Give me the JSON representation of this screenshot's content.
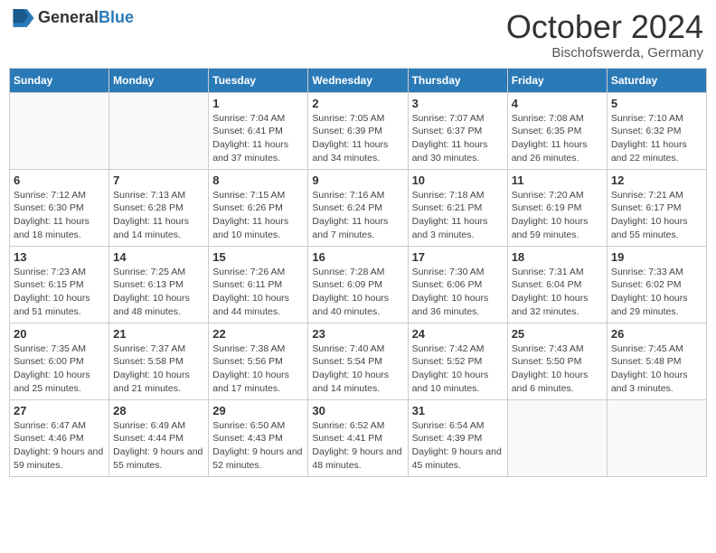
{
  "header": {
    "logo_general": "General",
    "logo_blue": "Blue",
    "month_title": "October 2024",
    "location": "Bischofswerda, Germany"
  },
  "days_of_week": [
    "Sunday",
    "Monday",
    "Tuesday",
    "Wednesday",
    "Thursday",
    "Friday",
    "Saturday"
  ],
  "weeks": [
    [
      {
        "day": "",
        "info": ""
      },
      {
        "day": "",
        "info": ""
      },
      {
        "day": "1",
        "info": "Sunrise: 7:04 AM\nSunset: 6:41 PM\nDaylight: 11 hours and 37 minutes."
      },
      {
        "day": "2",
        "info": "Sunrise: 7:05 AM\nSunset: 6:39 PM\nDaylight: 11 hours and 34 minutes."
      },
      {
        "day": "3",
        "info": "Sunrise: 7:07 AM\nSunset: 6:37 PM\nDaylight: 11 hours and 30 minutes."
      },
      {
        "day": "4",
        "info": "Sunrise: 7:08 AM\nSunset: 6:35 PM\nDaylight: 11 hours and 26 minutes."
      },
      {
        "day": "5",
        "info": "Sunrise: 7:10 AM\nSunset: 6:32 PM\nDaylight: 11 hours and 22 minutes."
      }
    ],
    [
      {
        "day": "6",
        "info": "Sunrise: 7:12 AM\nSunset: 6:30 PM\nDaylight: 11 hours and 18 minutes."
      },
      {
        "day": "7",
        "info": "Sunrise: 7:13 AM\nSunset: 6:28 PM\nDaylight: 11 hours and 14 minutes."
      },
      {
        "day": "8",
        "info": "Sunrise: 7:15 AM\nSunset: 6:26 PM\nDaylight: 11 hours and 10 minutes."
      },
      {
        "day": "9",
        "info": "Sunrise: 7:16 AM\nSunset: 6:24 PM\nDaylight: 11 hours and 7 minutes."
      },
      {
        "day": "10",
        "info": "Sunrise: 7:18 AM\nSunset: 6:21 PM\nDaylight: 11 hours and 3 minutes."
      },
      {
        "day": "11",
        "info": "Sunrise: 7:20 AM\nSunset: 6:19 PM\nDaylight: 10 hours and 59 minutes."
      },
      {
        "day": "12",
        "info": "Sunrise: 7:21 AM\nSunset: 6:17 PM\nDaylight: 10 hours and 55 minutes."
      }
    ],
    [
      {
        "day": "13",
        "info": "Sunrise: 7:23 AM\nSunset: 6:15 PM\nDaylight: 10 hours and 51 minutes."
      },
      {
        "day": "14",
        "info": "Sunrise: 7:25 AM\nSunset: 6:13 PM\nDaylight: 10 hours and 48 minutes."
      },
      {
        "day": "15",
        "info": "Sunrise: 7:26 AM\nSunset: 6:11 PM\nDaylight: 10 hours and 44 minutes."
      },
      {
        "day": "16",
        "info": "Sunrise: 7:28 AM\nSunset: 6:09 PM\nDaylight: 10 hours and 40 minutes."
      },
      {
        "day": "17",
        "info": "Sunrise: 7:30 AM\nSunset: 6:06 PM\nDaylight: 10 hours and 36 minutes."
      },
      {
        "day": "18",
        "info": "Sunrise: 7:31 AM\nSunset: 6:04 PM\nDaylight: 10 hours and 32 minutes."
      },
      {
        "day": "19",
        "info": "Sunrise: 7:33 AM\nSunset: 6:02 PM\nDaylight: 10 hours and 29 minutes."
      }
    ],
    [
      {
        "day": "20",
        "info": "Sunrise: 7:35 AM\nSunset: 6:00 PM\nDaylight: 10 hours and 25 minutes."
      },
      {
        "day": "21",
        "info": "Sunrise: 7:37 AM\nSunset: 5:58 PM\nDaylight: 10 hours and 21 minutes."
      },
      {
        "day": "22",
        "info": "Sunrise: 7:38 AM\nSunset: 5:56 PM\nDaylight: 10 hours and 17 minutes."
      },
      {
        "day": "23",
        "info": "Sunrise: 7:40 AM\nSunset: 5:54 PM\nDaylight: 10 hours and 14 minutes."
      },
      {
        "day": "24",
        "info": "Sunrise: 7:42 AM\nSunset: 5:52 PM\nDaylight: 10 hours and 10 minutes."
      },
      {
        "day": "25",
        "info": "Sunrise: 7:43 AM\nSunset: 5:50 PM\nDaylight: 10 hours and 6 minutes."
      },
      {
        "day": "26",
        "info": "Sunrise: 7:45 AM\nSunset: 5:48 PM\nDaylight: 10 hours and 3 minutes."
      }
    ],
    [
      {
        "day": "27",
        "info": "Sunrise: 6:47 AM\nSunset: 4:46 PM\nDaylight: 9 hours and 59 minutes."
      },
      {
        "day": "28",
        "info": "Sunrise: 6:49 AM\nSunset: 4:44 PM\nDaylight: 9 hours and 55 minutes."
      },
      {
        "day": "29",
        "info": "Sunrise: 6:50 AM\nSunset: 4:43 PM\nDaylight: 9 hours and 52 minutes."
      },
      {
        "day": "30",
        "info": "Sunrise: 6:52 AM\nSunset: 4:41 PM\nDaylight: 9 hours and 48 minutes."
      },
      {
        "day": "31",
        "info": "Sunrise: 6:54 AM\nSunset: 4:39 PM\nDaylight: 9 hours and 45 minutes."
      },
      {
        "day": "",
        "info": ""
      },
      {
        "day": "",
        "info": ""
      }
    ]
  ]
}
